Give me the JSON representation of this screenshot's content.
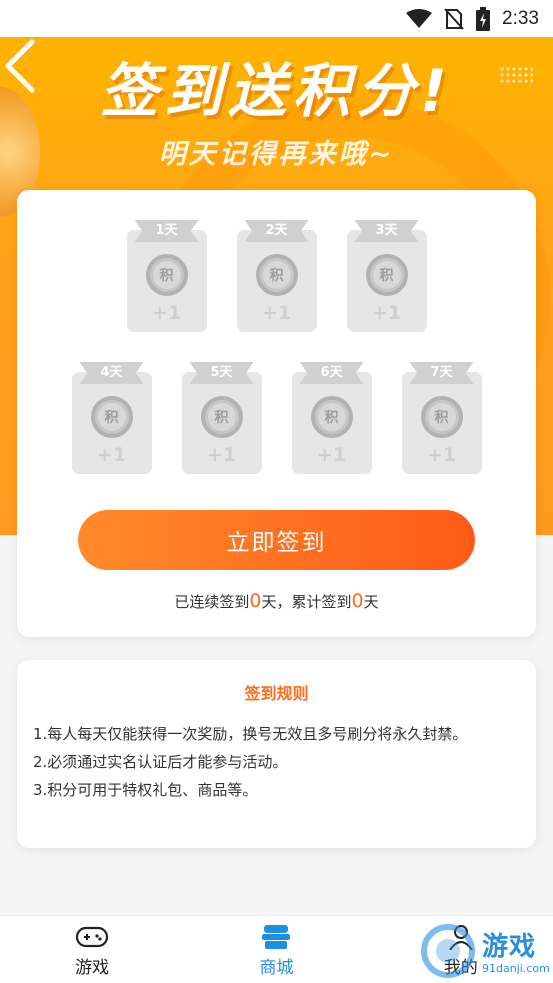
{
  "status_bar": {
    "time": "2:33"
  },
  "header": {
    "title": "签到送积分!",
    "subtitle": "明天记得再来哦~"
  },
  "checkin": {
    "days": [
      {
        "label": "1天",
        "coin": "积",
        "reward": "+1"
      },
      {
        "label": "2天",
        "coin": "积",
        "reward": "+1"
      },
      {
        "label": "3天",
        "coin": "积",
        "reward": "+1"
      },
      {
        "label": "4天",
        "coin": "积",
        "reward": "+1"
      },
      {
        "label": "5天",
        "coin": "积",
        "reward": "+1"
      },
      {
        "label": "6天",
        "coin": "积",
        "reward": "+1"
      },
      {
        "label": "7天",
        "coin": "积",
        "reward": "+1"
      }
    ],
    "button_label": "立即签到",
    "stats": {
      "consecutive_prefix": "已连续签到",
      "consecutive_days": "0",
      "middle": "天，累计签到",
      "total_days": "0",
      "suffix": "天"
    }
  },
  "rules": {
    "title": "签到规则",
    "items": [
      "1.每人每天仅能获得一次奖励，换号无效且多号刷分将永久封禁。",
      "2.必须通过实名认证后才能参与活动。",
      "3.积分可用于特权礼包、商品等。"
    ]
  },
  "tabbar": {
    "tabs": [
      {
        "label": "游戏",
        "icon": "gamepad-icon"
      },
      {
        "label": "商城",
        "icon": "store-icon"
      },
      {
        "label": "我的",
        "icon": "user-icon"
      }
    ],
    "active_index": 1
  },
  "watermark": {
    "text": "游戏",
    "url": "91danji.com"
  },
  "colors": {
    "accent": "#ff6d1a",
    "hero": "#ffa21a",
    "tab_active": "#1e8fe0"
  }
}
